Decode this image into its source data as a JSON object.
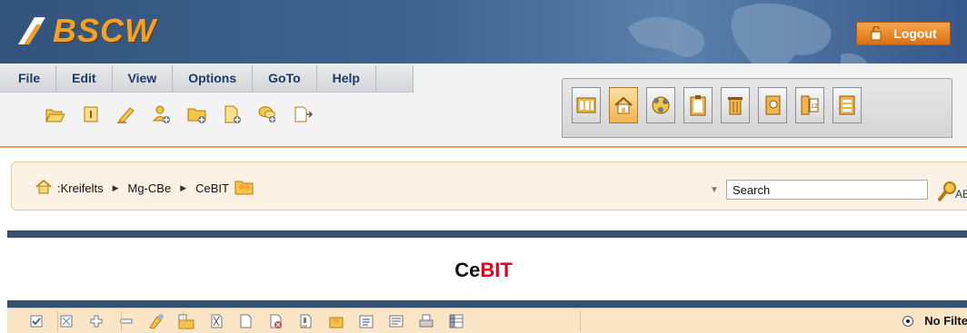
{
  "app": {
    "logo_text": "BSCW",
    "logout_label": "Logout"
  },
  "menu": [
    "File",
    "Edit",
    "View",
    "Options",
    "GoTo",
    "Help"
  ],
  "action_icons": [
    "open-folder-icon",
    "info-icon",
    "pencil-icon",
    "add-member-icon",
    "add-folder-icon",
    "add-document-icon",
    "add-discussion-icon",
    "export-icon"
  ],
  "view_buttons": [
    "board-view-icon",
    "home-icon",
    "workspace-map-icon",
    "clipboard-icon",
    "trash-icon",
    "address-book-icon",
    "calendar-icon",
    "tasks-icon"
  ],
  "breadcrumb": {
    "items": [
      ":Kreifelts",
      "Mg-CBe",
      "CeBIT"
    ]
  },
  "search": {
    "value": "Search"
  },
  "page_title": {
    "part1": "Ce",
    "part2": "BIT"
  },
  "list_toolbar": {
    "icons": [
      "select-all-icon",
      "deselect-icon",
      "expand-icon",
      "collapse-icon",
      "catch-up-icon",
      "send-icon",
      "cut-icon",
      "copy-icon",
      "delete-icon",
      "zip-icon",
      "rate-icon",
      "archive-icon",
      "report-icon",
      "print-icon",
      "table-icon"
    ],
    "filter_label": "No Filter"
  },
  "colors": {
    "header": "#3f6590",
    "accent_orange": "#e9a25c",
    "title_red": "#e3001b",
    "divider": "#354f6e"
  }
}
